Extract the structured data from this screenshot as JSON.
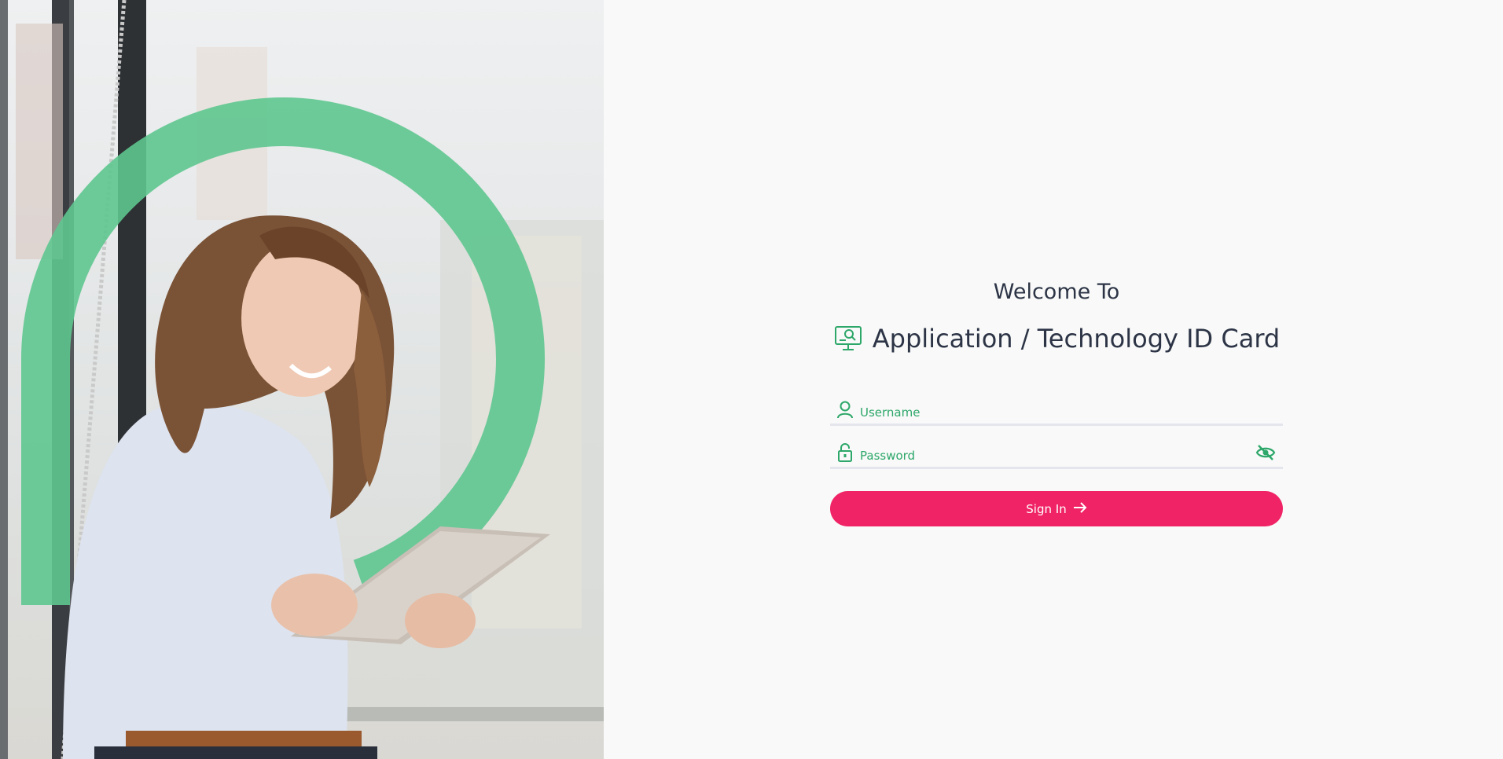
{
  "colors": {
    "accent_green": "#2ea76a",
    "ring_green": "#5ec78f",
    "button_pink": "#f02366",
    "text_dark": "#2c3446",
    "underline": "#e5e6ed",
    "background": "#f8f9f8"
  },
  "hero": {
    "image_alt": "Smiling woman using a tablet by a window with a green ring graphic"
  },
  "login": {
    "welcome": "Welcome To",
    "app_icon": "monitor-search-icon",
    "app_title": "Application / Technology ID Card",
    "username": {
      "icon": "user-icon",
      "placeholder": "Username",
      "value": ""
    },
    "password": {
      "icon": "lock-icon",
      "placeholder": "Password",
      "value": "",
      "toggle_icon": "eye-off-icon"
    },
    "signin_label": "Sign In",
    "signin_icon": "arrow-right-icon"
  }
}
